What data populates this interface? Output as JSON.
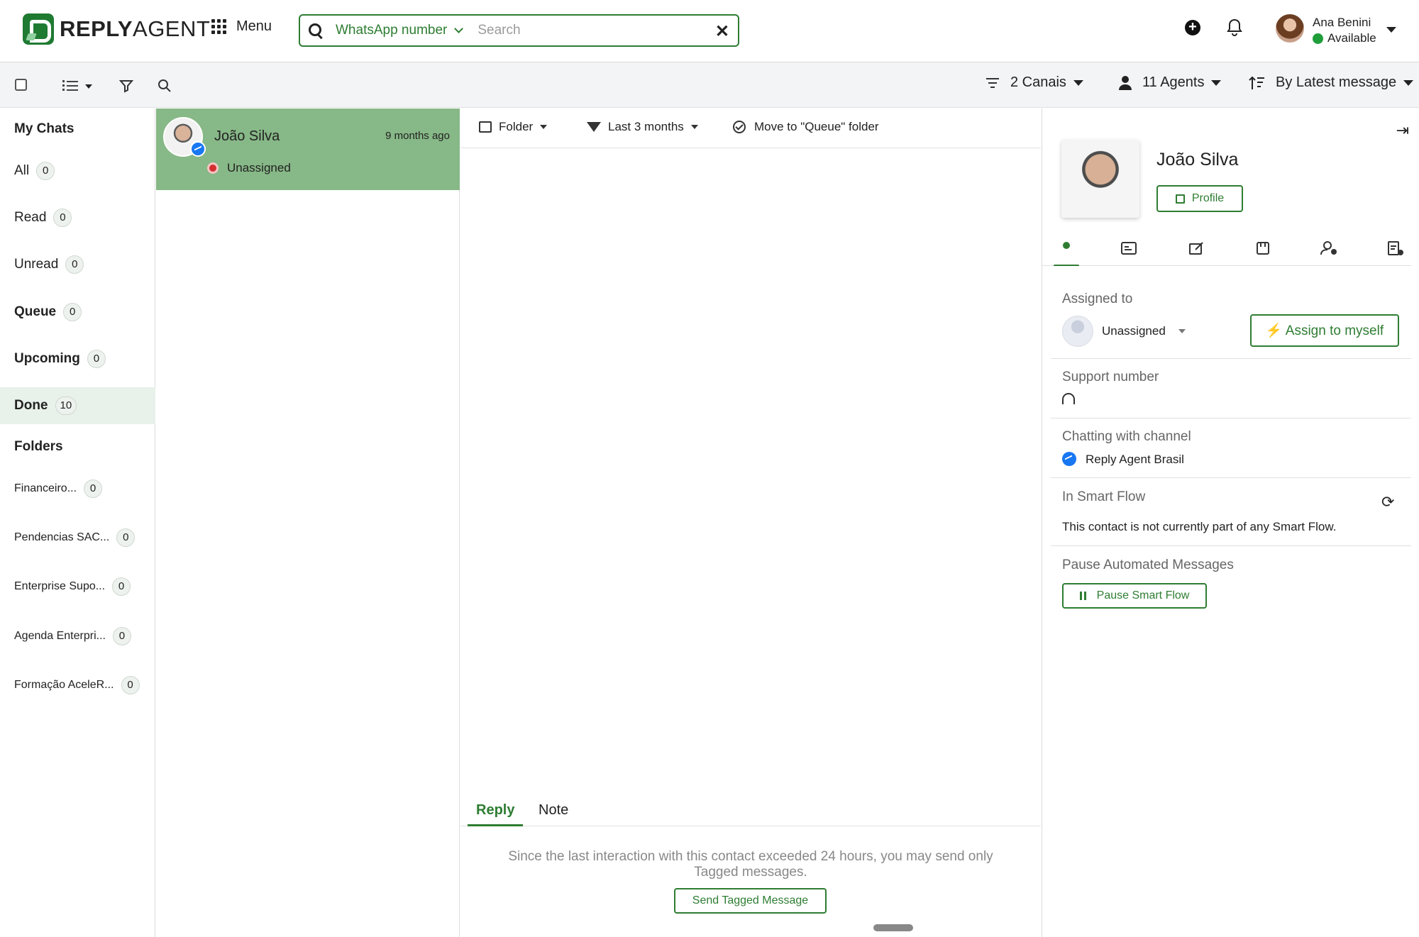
{
  "header": {
    "logo_bold": "REPLY",
    "logo_light": "AGENT",
    "menu_label": "Menu",
    "search_scope": "WhatsApp number",
    "search_placeholder": "Search",
    "clear_icon": "✕",
    "user_name": "Ana Benini",
    "user_status": "Available"
  },
  "toolbar": {
    "channels_label": "2 Canais",
    "agents_label": "11 Agents",
    "sort_label": "By Latest message"
  },
  "sidebar": {
    "my_chats_title": "My Chats",
    "items": [
      {
        "label": "All",
        "count": "0"
      },
      {
        "label": "Read",
        "count": "0"
      },
      {
        "label": "Unread",
        "count": "0"
      },
      {
        "label": "Queue",
        "count": "0"
      },
      {
        "label": "Upcoming",
        "count": "0"
      },
      {
        "label": "Done",
        "count": "10"
      }
    ],
    "folders_title": "Folders",
    "folders": [
      {
        "label": "Financeiro...",
        "count": "0"
      },
      {
        "label": "Pendencias SAC...",
        "count": "0"
      },
      {
        "label": "Enterprise Supo...",
        "count": "0"
      },
      {
        "label": "Agenda Enterpri...",
        "count": "0"
      },
      {
        "label": "Formação AceleR...",
        "count": "0"
      }
    ]
  },
  "chat_list": {
    "chats": [
      {
        "name": "João Silva",
        "time": "9 months ago",
        "status": "Unassigned"
      }
    ]
  },
  "conversation": {
    "folder_label": "Folder",
    "period_label": "Last 3 months",
    "move_label": "Move to \"Queue\" folder",
    "tab_reply": "Reply",
    "tab_note": "Note",
    "notice": "Since the last interaction with this contact exceeded 24 hours, you may send only Tagged messages.",
    "send_tagged_label": "Send Tagged Message"
  },
  "contact_panel": {
    "name": "João Silva",
    "profile_label": "Profile",
    "assigned_to_label": "Assigned to",
    "assignee": "Unassigned",
    "assign_button": "⚡ Assign to myself",
    "support_number_label": "Support number",
    "chatting_channel_label": "Chatting with channel",
    "channel_name": "Reply Agent Brasil",
    "smart_flow_label": "In Smart Flow",
    "smart_flow_text": "This contact is not currently part of any Smart Flow.",
    "pause_label": "Pause Automated Messages",
    "pause_button": "Pause Smart Flow",
    "collapse_icon": "⇥",
    "refresh_icon": "⟳"
  },
  "colors": {
    "brand_green": "#2e7d32",
    "selected_chat_bg": "#87b887",
    "active_sidebar_bg": "#e8f1ea",
    "status_available": "#1f9d3a",
    "status_unassigned": "#d32f2f",
    "messenger_blue": "#1877f2"
  }
}
